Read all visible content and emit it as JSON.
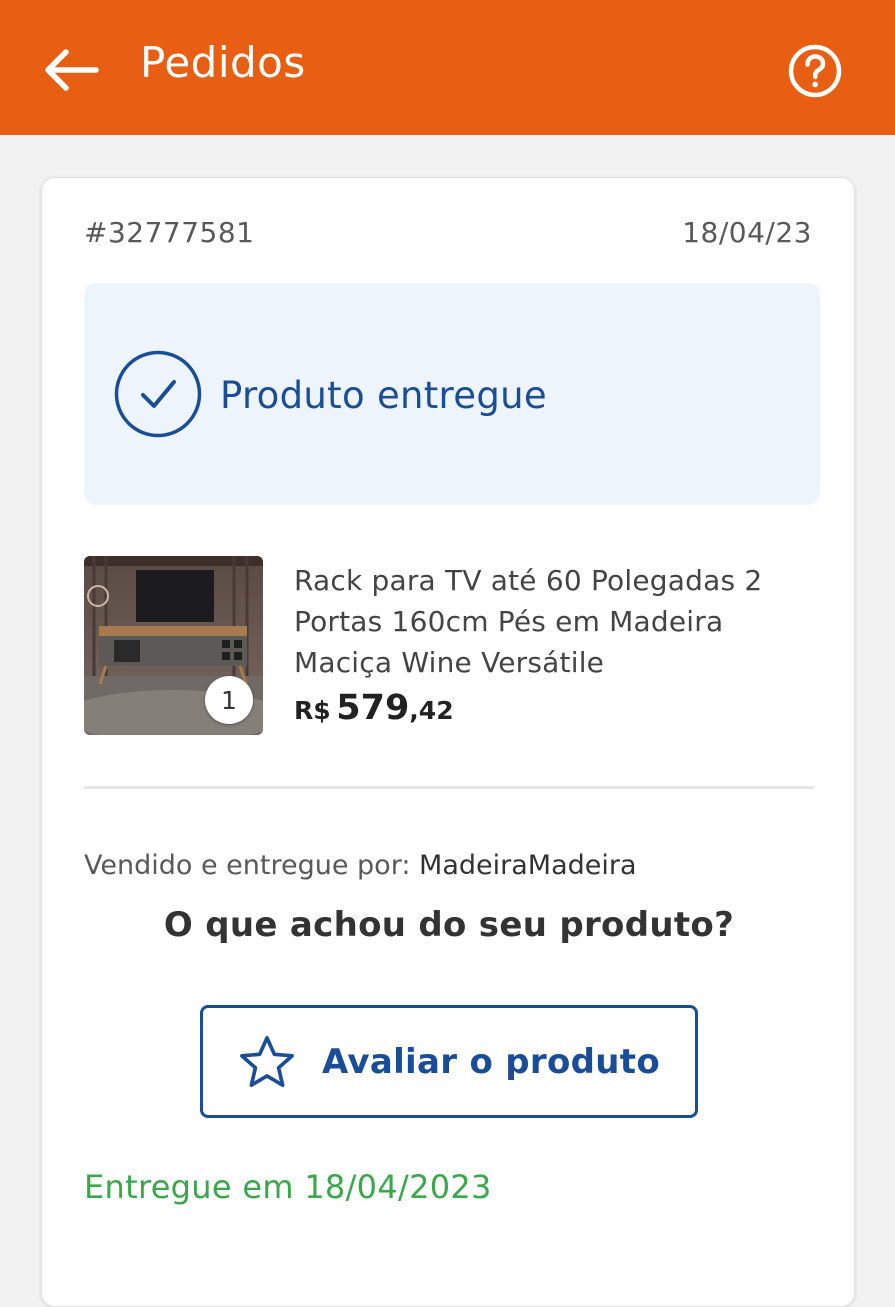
{
  "header": {
    "title": "Pedidos",
    "back_icon": "arrow-left-icon",
    "help_icon": "help-circle-icon"
  },
  "order": {
    "number": "#32777581",
    "date": "18/04/23",
    "status": {
      "text": "Produto entregue",
      "icon": "check-circle-icon"
    },
    "product": {
      "name": "Rack para TV até 60 Polegadas 2 Portas 160cm Pés em Madeira Maciça Wine Versátile",
      "quantity": "1",
      "price": {
        "currency": "R$",
        "integer": "579",
        "decimal": ",42"
      }
    },
    "seller": {
      "prefix": "Vendido e entregue por:",
      "name": "MadeiraMadeira"
    },
    "review": {
      "question": "O que achou do seu produto?",
      "button_label": "Avaliar o produto",
      "button_icon": "star-outline-icon"
    },
    "delivered_text": "Entregue em 18/04/2023"
  },
  "colors": {
    "appbar": "#e85f14",
    "primary_blue": "#1a4d98",
    "status_bg": "#eef4fb",
    "success_green": "#3aa84a"
  }
}
